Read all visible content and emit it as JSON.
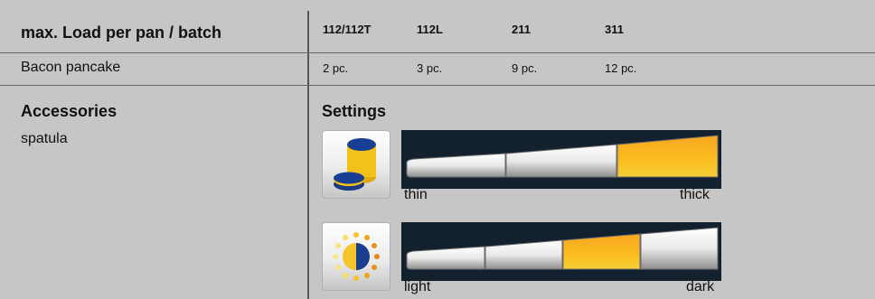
{
  "header": {
    "title": "max. Load per pan / batch",
    "models": [
      "112/112T",
      "112L",
      "211",
      "311"
    ]
  },
  "load_row": {
    "product": "Bacon pancake",
    "values": [
      "2 pc.",
      "3 pc.",
      "9 pc.",
      "12 pc."
    ]
  },
  "accessories": {
    "title": "Accessories",
    "item": "spatula"
  },
  "settings": {
    "title": "Settings",
    "thickness": {
      "icon": "pancake-thickness-icon",
      "min_label": "thin",
      "max_label": "thick",
      "segments": 3,
      "selected_segment": 3
    },
    "browning": {
      "icon": "browning-level-icon",
      "min_label": "light",
      "max_label": "dark",
      "segments": 4,
      "selected_segment": 3
    }
  },
  "colors": {
    "background": "#c6c6c6",
    "slider_background": "#13202d",
    "highlight": "#f7a81b"
  }
}
